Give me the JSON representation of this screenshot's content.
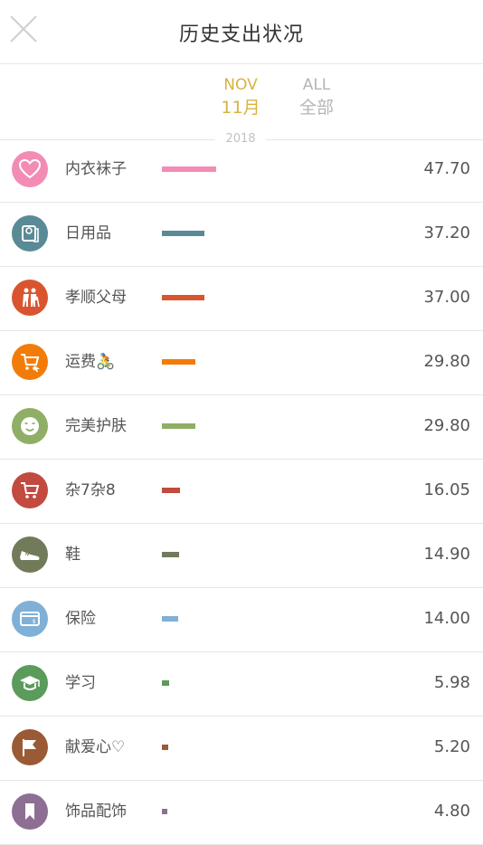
{
  "header": {
    "title": "历史支出状况"
  },
  "tabs": [
    {
      "en": "NOV",
      "cn": "11月",
      "active": true
    },
    {
      "en": "ALL",
      "cn": "全部",
      "active": false
    }
  ],
  "year": "2018",
  "colors": {
    "accent": "#d9b23f",
    "inactive": "#b5b5b5",
    "divider": "#e6e6e6"
  },
  "items": [
    {
      "label": "内衣袜子",
      "amount": "47.70",
      "value": 47.7,
      "color": "#f38cb5",
      "icon": "heart-icon"
    },
    {
      "label": "日用品",
      "amount": "37.20",
      "value": 37.2,
      "color": "#5a8a96",
      "icon": "toilet-paper-icon"
    },
    {
      "label": "孝顺父母",
      "amount": "37.00",
      "value": 37.0,
      "color": "#d8552f",
      "icon": "parents-icon"
    },
    {
      "label": "运费🚴",
      "amount": "29.80",
      "value": 29.8,
      "color": "#f27c0a",
      "icon": "cart-icon"
    },
    {
      "label": "完美护肤",
      "amount": "29.80",
      "value": 29.8,
      "color": "#8fae66",
      "icon": "face-mask-icon"
    },
    {
      "label": "杂7杂8",
      "amount": "16.05",
      "value": 16.05,
      "color": "#c24a3f",
      "icon": "shopping-cart-icon"
    },
    {
      "label": "鞋",
      "amount": "14.90",
      "value": 14.9,
      "color": "#717b5a",
      "icon": "shoe-icon"
    },
    {
      "label": "保险",
      "amount": "14.00",
      "value": 14.0,
      "color": "#7fb0d8",
      "icon": "card-icon"
    },
    {
      "label": "学习",
      "amount": "5.98",
      "value": 5.98,
      "color": "#5b9b5b",
      "icon": "graduation-cap-icon"
    },
    {
      "label": "献爱心♡",
      "amount": "5.20",
      "value": 5.2,
      "color": "#9a5a35",
      "icon": "flag-icon"
    },
    {
      "label": "饰品配饰",
      "amount": "4.80",
      "value": 4.8,
      "color": "#8d6f93",
      "icon": "bookmark-icon"
    }
  ]
}
